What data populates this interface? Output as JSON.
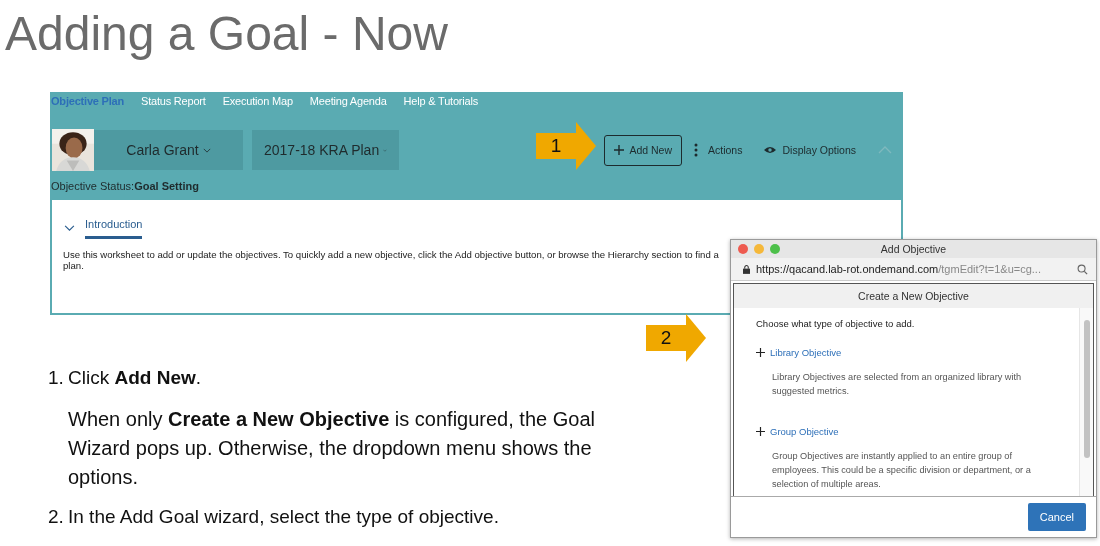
{
  "slide_title": "Adding a Goal - Now",
  "app": {
    "nav": [
      {
        "label": "Objective Plan",
        "selected": true
      },
      {
        "label": "Status Report",
        "selected": false
      },
      {
        "label": "Execution Map",
        "selected": false
      },
      {
        "label": "Meeting Agenda",
        "selected": false
      },
      {
        "label": "Help & Tutorials",
        "selected": false
      }
    ],
    "user_name": "Carla Grant",
    "plan": "2017-18 KRA Plan",
    "add_new": "Add New",
    "actions": "Actions",
    "display_options": "Display Options",
    "status_label": "Objective Status:",
    "status_value": "Goal Setting",
    "section": {
      "title": "Introduction",
      "expanded": true,
      "text": "Use this worksheet to add or update the objectives. To quickly add a new objective, click the Add objective button, or browse the Hierarchy section to find a\nplan."
    }
  },
  "callouts": [
    "1",
    "2"
  ],
  "dialog": {
    "window_title": "Add Objective",
    "url_host": "https://qacand.lab-rot.ondemand.com",
    "url_path": "/tgmEdit?t=1&u=cg...",
    "header": "Create a New Objective",
    "prompt": "Choose what type of objective to add.",
    "options": [
      {
        "title": "Library Objective",
        "description": "Library Objectives are selected from an organized library with suggested metrics."
      },
      {
        "title": "Group Objective",
        "description": "Group Objectives are instantly applied to an entire group of employees. This could be a specific division or department, or a selection of multiple areas."
      }
    ],
    "cancel": "Cancel"
  },
  "instructions": [
    {
      "number": "1.",
      "text": "Click **Add New**.",
      "note": "When only **Create a New Objective** is configured, the Goal Wizard pops up. Otherwise, the dropdown menu shows the options."
    },
    {
      "number": "2.",
      "text": "In the Add Goal wizard, select the type of objective."
    }
  ]
}
